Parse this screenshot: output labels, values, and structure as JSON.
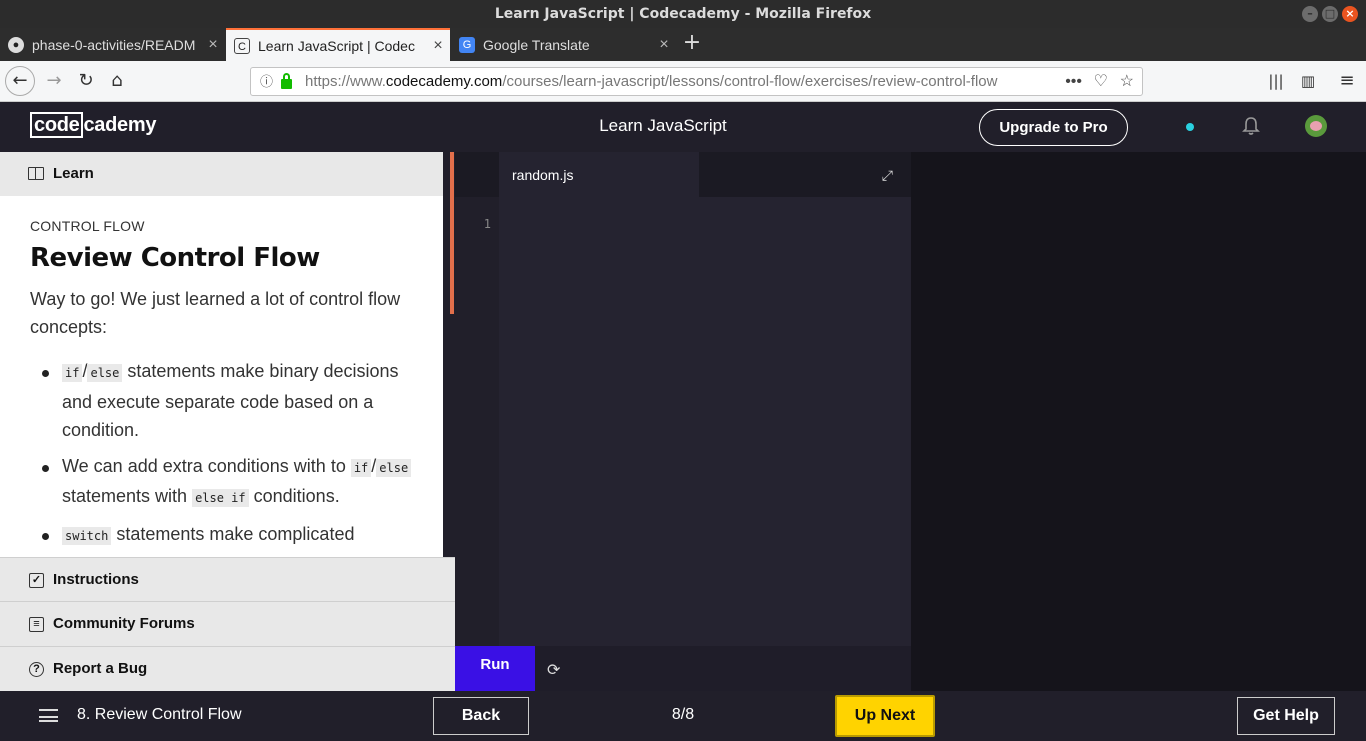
{
  "window": {
    "title": "Learn JavaScript | Codecademy - Mozilla Firefox"
  },
  "tabs": [
    {
      "label": "phase-0-activities/READM",
      "icon": "github-icon"
    },
    {
      "label": "Learn JavaScript | Codec",
      "icon": "codecademy-favicon"
    },
    {
      "label": "Google Translate",
      "icon": "google-translate-icon"
    }
  ],
  "urlbar": {
    "scheme": "https://www.",
    "host": "codecademy.com",
    "path": "/courses/learn-javascript/lessons/control-flow/exercises/review-control-flow"
  },
  "header": {
    "logo_left": "code",
    "logo_right": "cademy",
    "course_title": "Learn JavaScript",
    "upgrade_label": "Upgrade to Pro"
  },
  "learn": {
    "tab_label": "Learn",
    "eyebrow": "CONTROL FLOW",
    "title": "Review Control Flow",
    "intro": "Way to go! We just learned a lot of control flow concepts:",
    "bullet1": {
      "code_a": "if",
      "sep": "/",
      "code_b": "else",
      "text": " statements make binary decisions and execute separate code based on a condition."
    },
    "bullet2": {
      "text_a": "We can add extra conditions with to ",
      "code_a": "if",
      "sep": "/",
      "code_b": "else",
      "text_b": " statements with ",
      "code_c": "else if",
      "text_c": " conditions."
    },
    "bullet3": {
      "code_a": "switch",
      "text": " statements make complicated"
    }
  },
  "footer_panels": {
    "instructions": "Instructions",
    "forums": "Community Forums",
    "bug": "Report a Bug"
  },
  "editor": {
    "filename": "random.js",
    "line_numbers": [
      "1"
    ],
    "run_label": "Run"
  },
  "bottombar": {
    "lesson": "8. Review Control Flow",
    "back": "Back",
    "progress": "8/8",
    "up_next": "Up Next",
    "get_help": "Get Help"
  },
  "colors": {
    "accent_run": "#3a10e5",
    "up_next": "#ffd300",
    "editor_bg": "#252330",
    "status_dot": "#2ad0e0"
  }
}
